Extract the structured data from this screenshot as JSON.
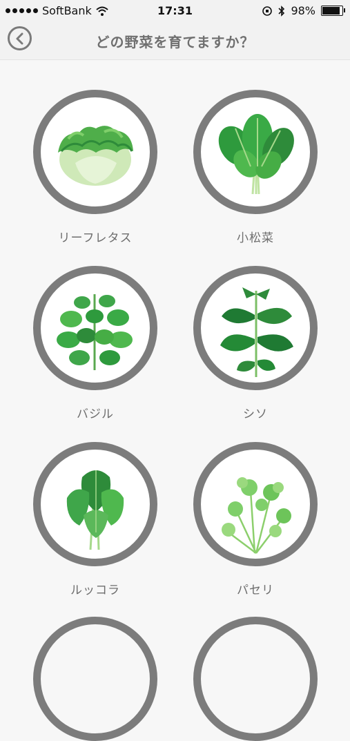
{
  "status_bar": {
    "carrier": "SoftBank",
    "time": "17:31",
    "battery": "98%",
    "battery_level": 0.98
  },
  "nav": {
    "title": "どの野菜を育てますか？"
  },
  "vegetables": [
    {
      "label": "リーフレタス",
      "icon": "leaf-lettuce-illustration"
    },
    {
      "label": "小松菜",
      "icon": "komatsuna-illustration"
    },
    {
      "label": "バジル",
      "icon": "basil-illustration"
    },
    {
      "label": "シソ",
      "icon": "shiso-illustration"
    },
    {
      "label": "ルッコラ",
      "icon": "arugula-illustration"
    },
    {
      "label": "パセリ",
      "icon": "parsley-illustration"
    }
  ],
  "colors": {
    "ring": "#7c7c7c",
    "label_text": "#6d6d6d",
    "leaf_dark": "#2e8b3a",
    "leaf_light": "#7fcf6a"
  }
}
